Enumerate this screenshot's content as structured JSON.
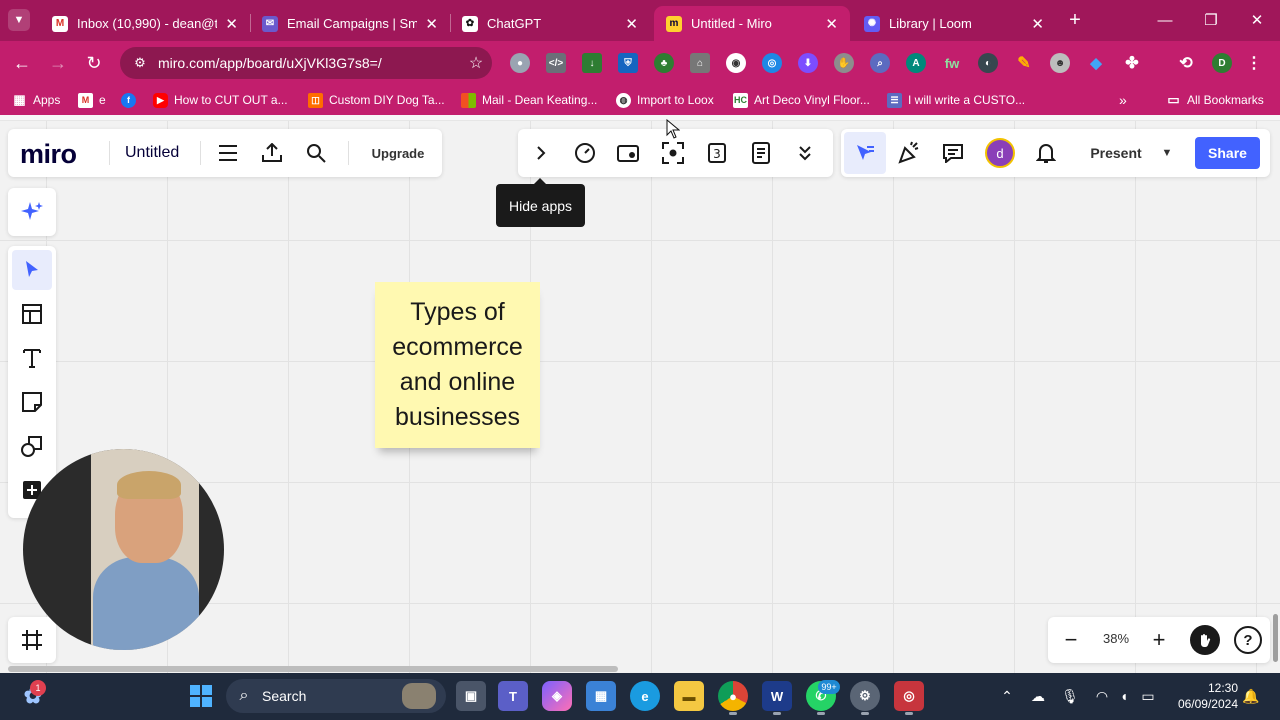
{
  "browser": {
    "tabs": [
      {
        "title": "Inbox (10,990) - dean@th",
        "icon": "gmail-icon",
        "color": "#ffffff"
      },
      {
        "title": "Email Campaigns | Smart",
        "icon": "campaign-icon",
        "color": "#6a5acd"
      },
      {
        "title": "ChatGPT",
        "icon": "chatgpt-icon",
        "color": "#ffffff"
      },
      {
        "title": "Untitled - Miro",
        "icon": "miro-icon",
        "color": "#ffd02f",
        "active": true
      },
      {
        "title": "Library | Loom",
        "icon": "loom-icon",
        "color": "#625df5"
      }
    ],
    "url": "miro.com/app/board/uXjVKl3G7s8=/",
    "profile_initial": "D",
    "bookmarks": [
      {
        "label": "Apps",
        "icon": "apps-grid-icon"
      },
      {
        "label": "e",
        "icon": "gmail-icon"
      },
      {
        "label": "",
        "icon": "facebook-icon"
      },
      {
        "label": "How to CUT OUT a...",
        "icon": "youtube-icon"
      },
      {
        "label": "Custom DIY Dog Ta...",
        "icon": "bookmark-icon"
      },
      {
        "label": "Mail - Dean Keating...",
        "icon": "microsoft-icon"
      },
      {
        "label": "Import to Loox",
        "icon": "globe-icon"
      },
      {
        "label": "Art Deco Vinyl Floor...",
        "icon": "hc-icon"
      },
      {
        "label": "I will write a CUSTO...",
        "icon": "list-icon"
      }
    ],
    "all_bookmarks": "All Bookmarks"
  },
  "miro": {
    "logo": "miro",
    "board_title": "Untitled",
    "upgrade": "Upgrade",
    "tooltip": "Hide apps",
    "user_initial": "d",
    "present": "Present",
    "share": "Share",
    "zoom": "38%",
    "sticky_note": "Types of ecommerce and online businesses"
  },
  "taskbar": {
    "search": "Search",
    "notification_count": "1",
    "whatsapp_badge": "99+",
    "time": "12:30",
    "date": "06/09/2024"
  },
  "colors": {
    "tab_strip": "#a0175a",
    "toolbar": "#c21e6d",
    "share_button": "#4262ff",
    "sticky_note": "#fff9b1",
    "taskbar": "#1f2a3c"
  }
}
